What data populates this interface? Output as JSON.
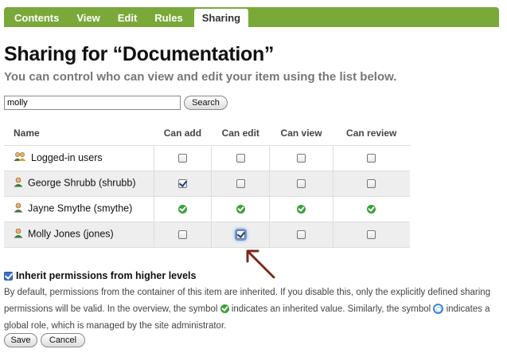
{
  "tabs": [
    {
      "label": "Contents",
      "active": false
    },
    {
      "label": "View",
      "active": false
    },
    {
      "label": "Edit",
      "active": false
    },
    {
      "label": "Rules",
      "active": false
    },
    {
      "label": "Sharing",
      "active": true
    }
  ],
  "colors": {
    "tabbar": "#7aa93a",
    "inherited": "#3aa13a",
    "focus": "#6a9be0",
    "arrow": "#7a2a1a"
  },
  "page": {
    "title": "Sharing for “Documentation”",
    "description": "You can control who can view and edit your item using the list below."
  },
  "search": {
    "value": "molly",
    "button": "Search"
  },
  "table": {
    "headers": [
      "Name",
      "Can add",
      "Can edit",
      "Can view",
      "Can review"
    ],
    "rows": [
      {
        "name": "Logged-in users",
        "icon": "group-icon",
        "perms": [
          "unchecked",
          "unchecked",
          "unchecked",
          "unchecked"
        ]
      },
      {
        "name": "George Shrubb (shrubb)",
        "icon": "user-icon",
        "perms": [
          "checked",
          "unchecked",
          "unchecked",
          "unchecked"
        ]
      },
      {
        "name": "Jayne Smythe (smythe)",
        "icon": "user-icon",
        "perms": [
          "inherited",
          "inherited",
          "inherited",
          "inherited"
        ]
      },
      {
        "name": "Molly Jones (jones)",
        "icon": "user-icon",
        "perms": [
          "unchecked",
          "checked-focused",
          "unchecked",
          "unchecked"
        ]
      }
    ]
  },
  "inherit": {
    "label": "Inherit permissions from higher levels",
    "checked": true
  },
  "help": {
    "part1": "By default, permissions from the container of this item are inherited. If you disable this, only the explicitly defined sharing permissions will be valid. In the overview, the symbol ",
    "part2": " indicates an inherited value. Similarly, the symbol ",
    "part3": " indicates a global role, which is managed by the site administrator."
  },
  "buttons": {
    "save": "Save",
    "cancel": "Cancel"
  }
}
